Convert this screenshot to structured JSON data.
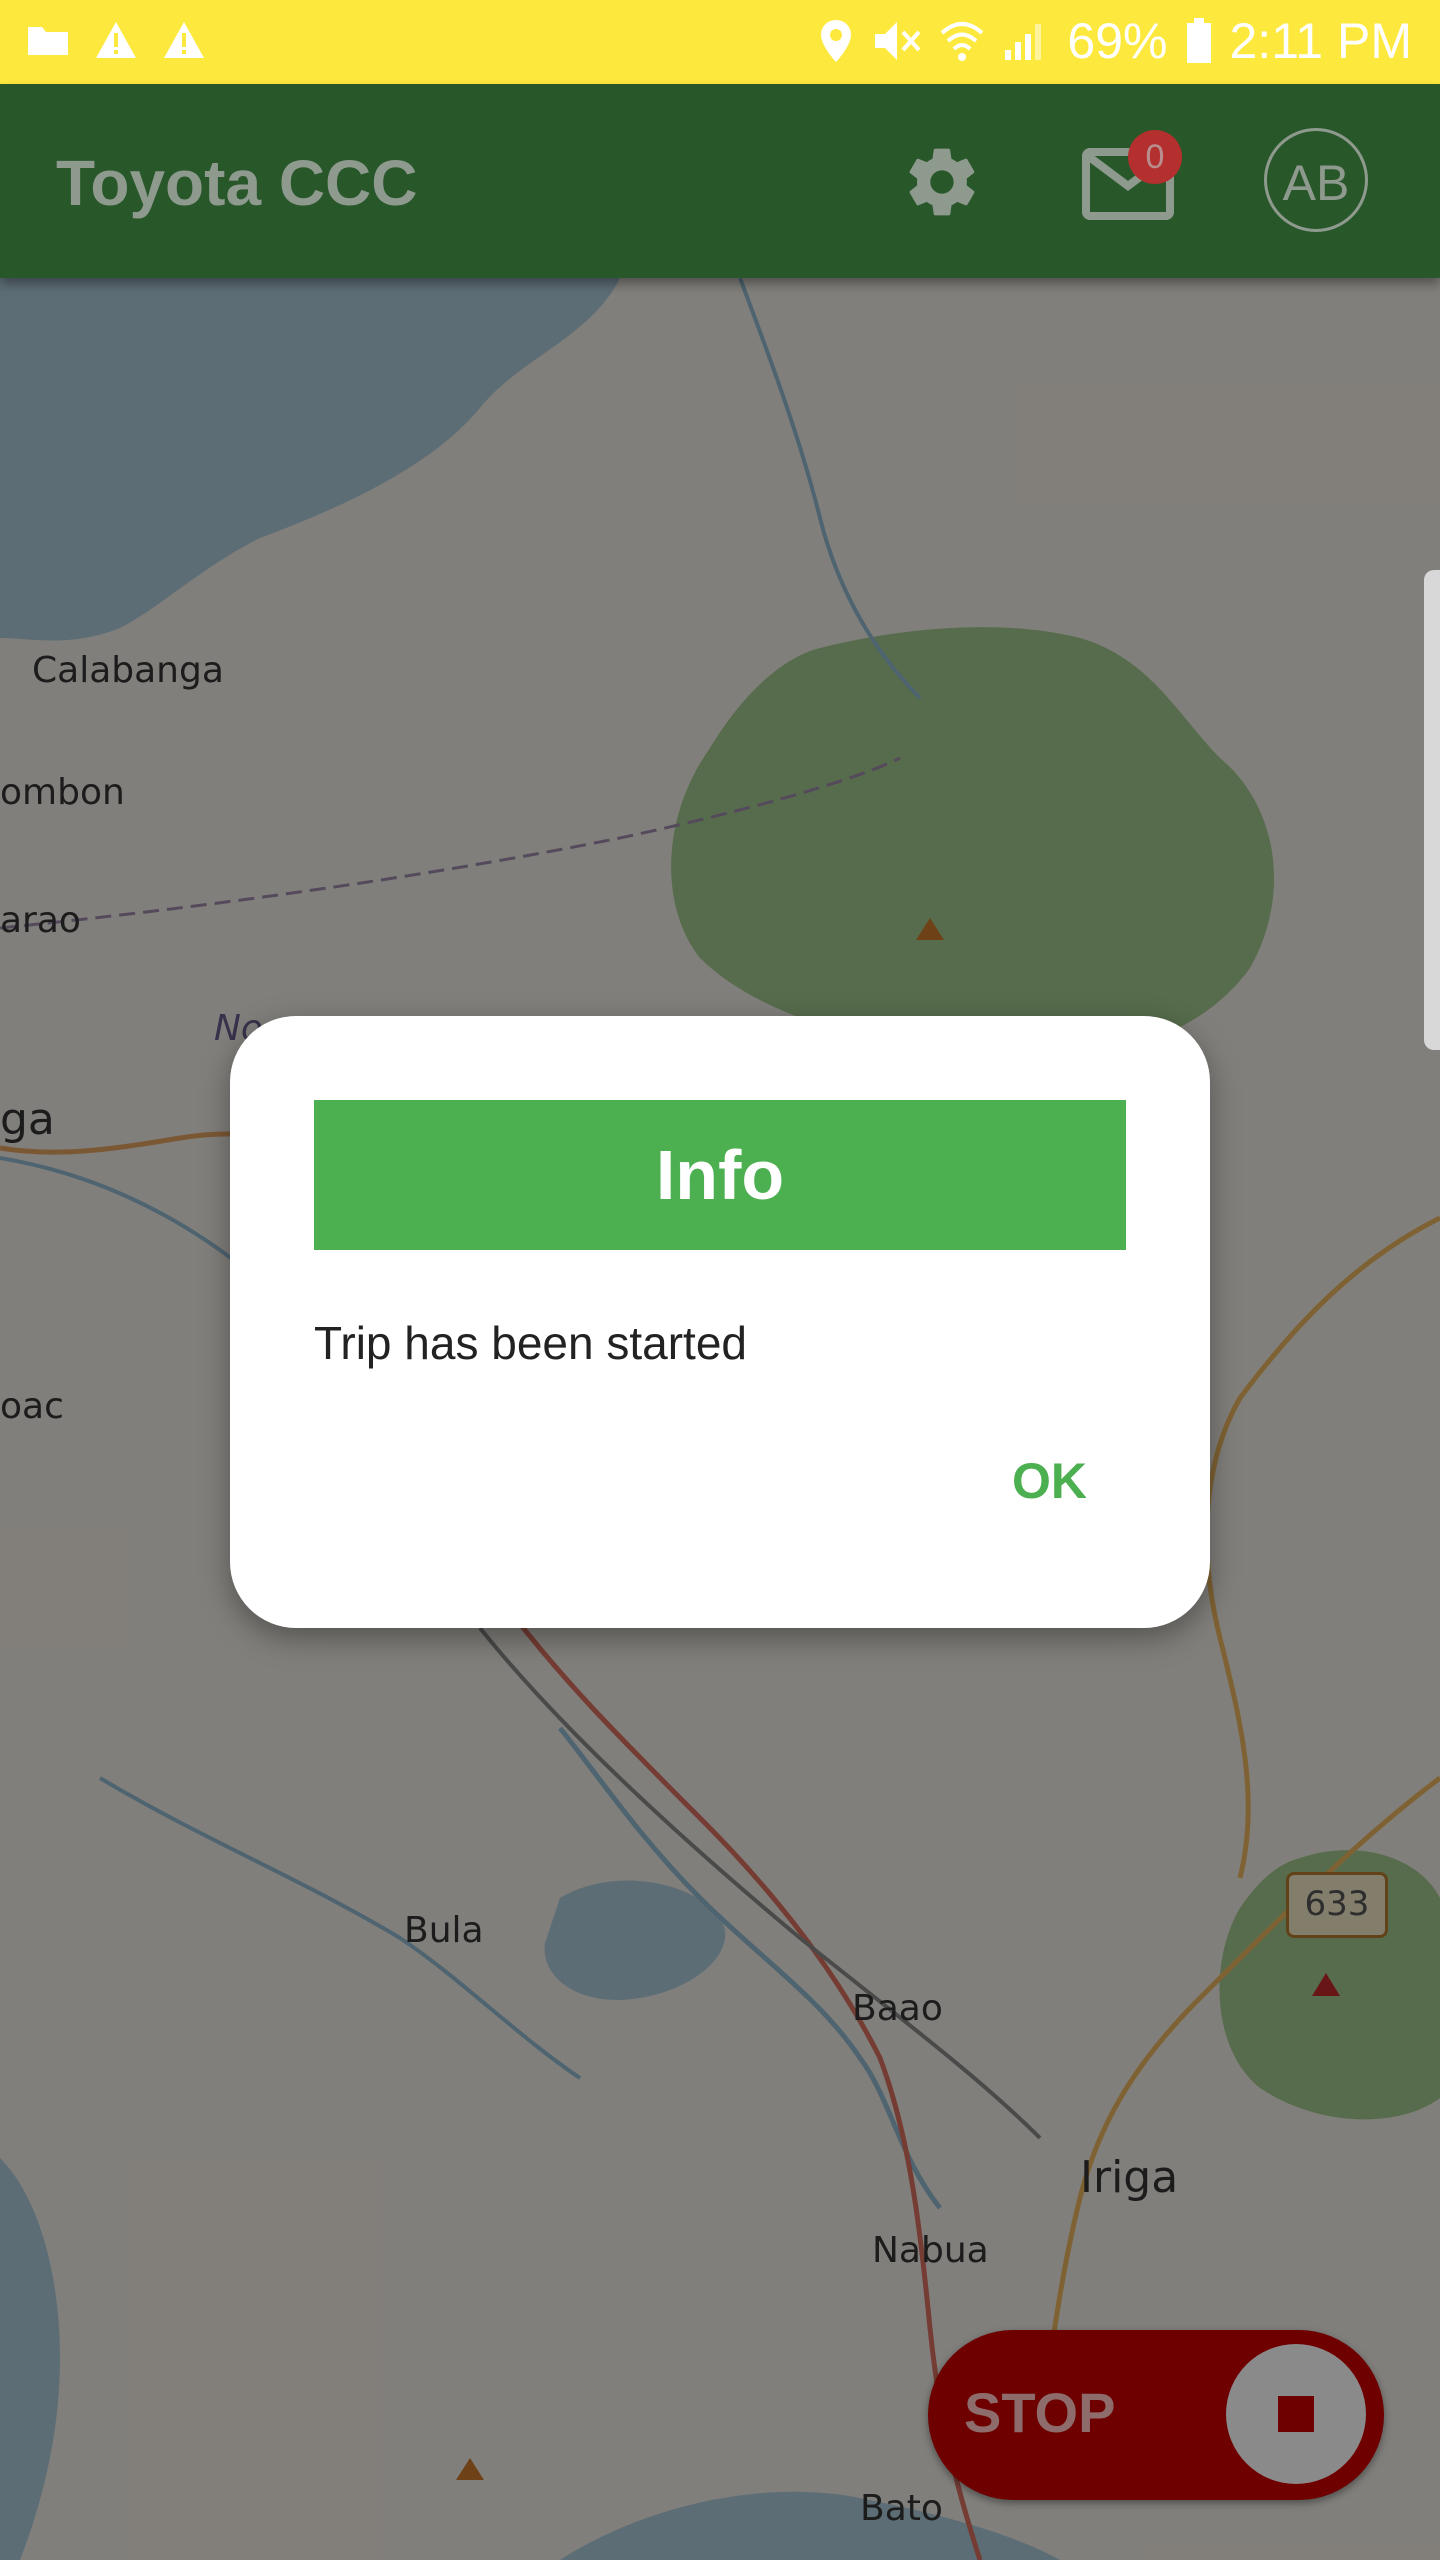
{
  "status_bar": {
    "battery": "69%",
    "time": "2:11 PM",
    "icons": [
      "folder-icon",
      "warning-icon",
      "warning-icon",
      "location-icon",
      "mute-icon",
      "wifi-icon",
      "signal-icon",
      "battery-icon"
    ]
  },
  "app_bar": {
    "title": "Toyota CCC",
    "mail_badge": "0",
    "avatar_initials": "AB",
    "icons": [
      "gear-icon",
      "mail-icon"
    ]
  },
  "map": {
    "labels": [
      "Calabanga",
      "ombon",
      "arao",
      "ga",
      "oac",
      "Bula",
      "Baao",
      "Iriga",
      "Nabua",
      "Bato",
      "No"
    ],
    "road_shield": "633"
  },
  "dialog": {
    "title": "Info",
    "message": "Trip has been started",
    "ok_label": "OK"
  },
  "stop_button": {
    "label": "STOP"
  },
  "colors": {
    "status_bar": "#fde93d",
    "app_bar": "#28572a",
    "dialog_header": "#4caf50",
    "ok_text": "#4caf50",
    "stop_button": "#6e0000"
  }
}
